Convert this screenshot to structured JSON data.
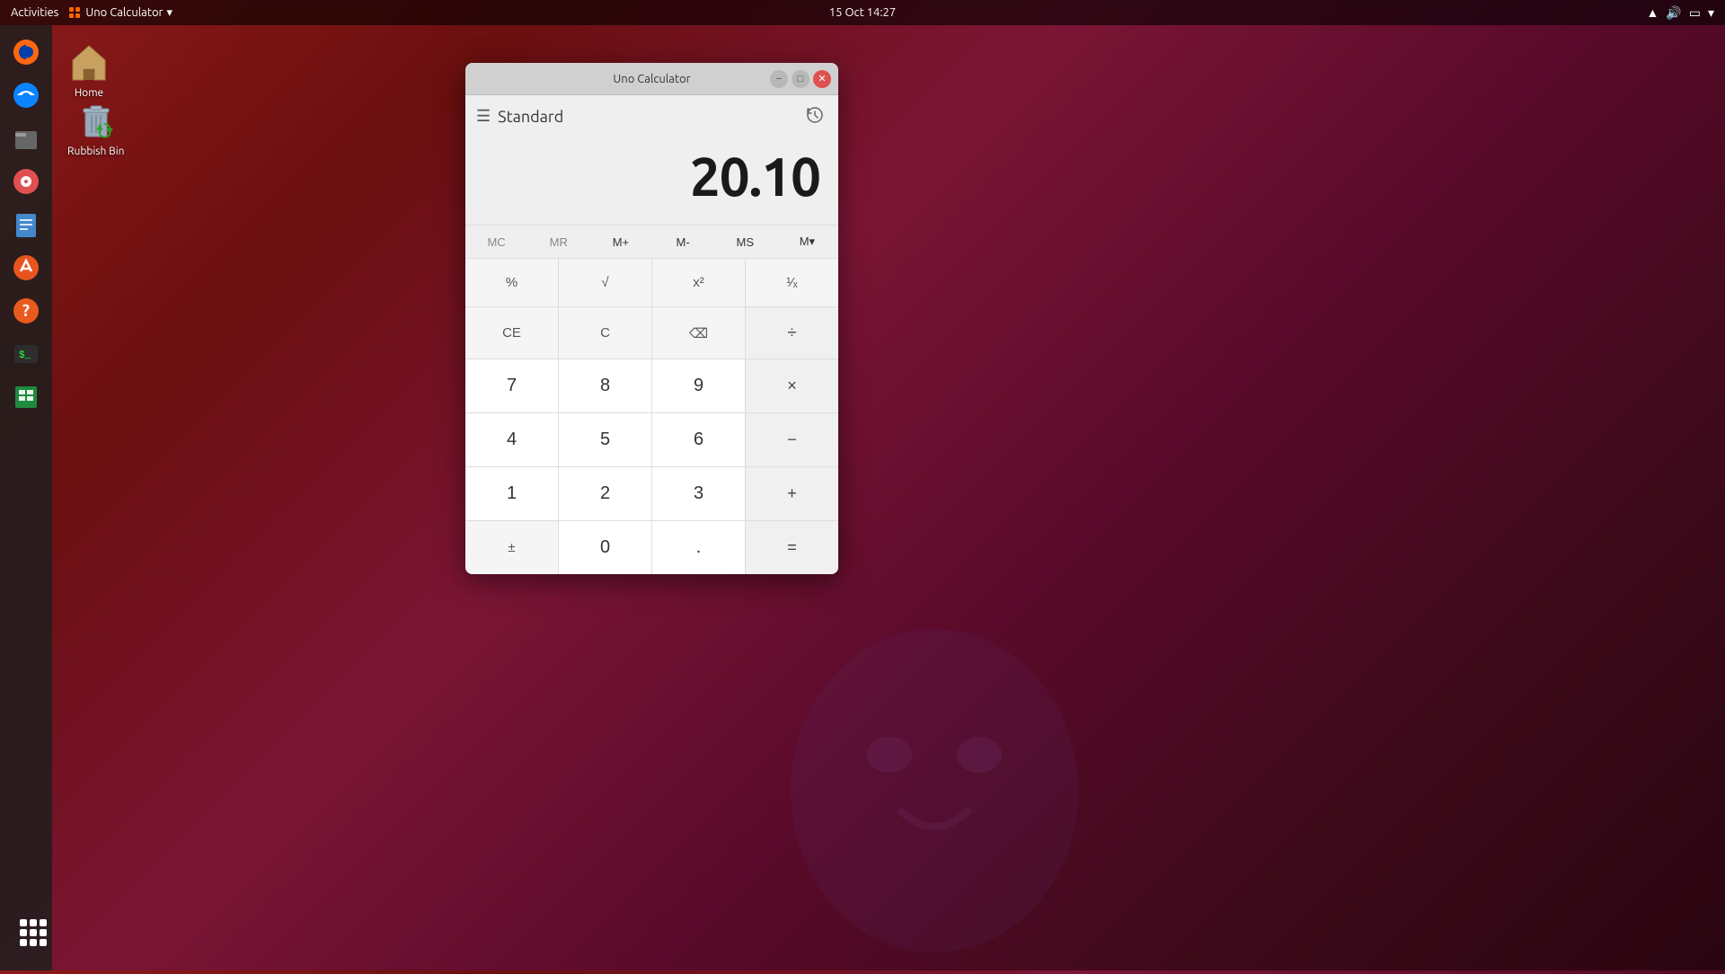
{
  "topbar": {
    "activities": "Activities",
    "app_name": "Uno Calculator",
    "datetime": "15 Oct  14:27"
  },
  "desktop": {
    "icons": [
      {
        "id": "home",
        "label": "Home",
        "type": "home"
      },
      {
        "id": "rubbish-bin",
        "label": "Rubbish Bin",
        "type": "trash"
      }
    ]
  },
  "calculator": {
    "window_title": "Uno Calculator",
    "mode": "Standard",
    "display": "20.10",
    "memory_buttons": [
      "MC",
      "MR",
      "M+",
      "M-",
      "MS",
      "M▾"
    ],
    "buttons": [
      "%",
      "√",
      "x²",
      "¹⁄ₓ",
      "CE",
      "C",
      "⌫",
      "÷",
      "7",
      "8",
      "9",
      "×",
      "4",
      "5",
      "6",
      "−",
      "1",
      "2",
      "3",
      "+",
      "±",
      "0",
      ".",
      "="
    ]
  },
  "sidebar": {
    "apps": [
      {
        "id": "firefox",
        "label": "Firefox"
      },
      {
        "id": "thunderbird",
        "label": "Thunderbird"
      },
      {
        "id": "files",
        "label": "Files"
      },
      {
        "id": "rhythmbox",
        "label": "Rhythmbox"
      },
      {
        "id": "notes",
        "label": "Notes"
      },
      {
        "id": "appstore",
        "label": "App Store"
      },
      {
        "id": "help",
        "label": "Help"
      },
      {
        "id": "terminal",
        "label": "Terminal"
      },
      {
        "id": "spreadsheet",
        "label": "Spreadsheet"
      }
    ]
  }
}
